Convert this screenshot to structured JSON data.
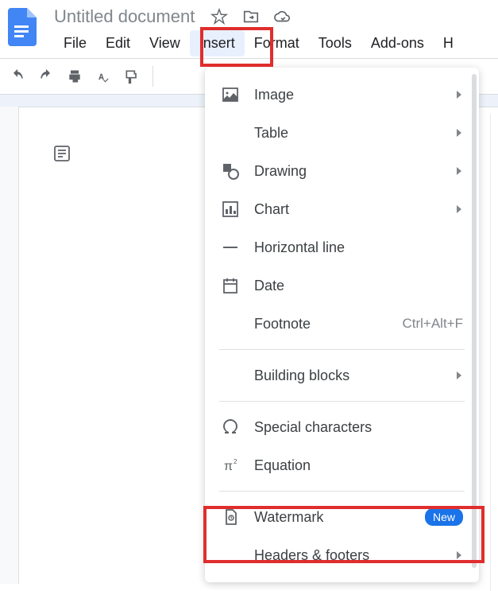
{
  "header": {
    "title": "Untitled document"
  },
  "menubar": {
    "items": [
      "File",
      "Edit",
      "View",
      "Insert",
      "Format",
      "Tools",
      "Add-ons",
      "H"
    ],
    "active_index": 3
  },
  "dropdown": {
    "items": [
      {
        "label": "Image",
        "icon": "image",
        "arrow": true
      },
      {
        "label": "Table",
        "icon": "",
        "arrow": true
      },
      {
        "label": "Drawing",
        "icon": "drawing",
        "arrow": true
      },
      {
        "label": "Chart",
        "icon": "chart",
        "arrow": true
      },
      {
        "label": "Horizontal line",
        "icon": "hline",
        "arrow": false
      },
      {
        "label": "Date",
        "icon": "date",
        "arrow": false
      },
      {
        "label": "Footnote",
        "icon": "",
        "arrow": false,
        "shortcut": "Ctrl+Alt+F"
      },
      {
        "sep": true
      },
      {
        "label": "Building blocks",
        "icon": "",
        "arrow": true
      },
      {
        "sep": true
      },
      {
        "label": "Special characters",
        "icon": "omega",
        "arrow": false
      },
      {
        "label": "Equation",
        "icon": "pi",
        "arrow": false
      },
      {
        "sep": true
      },
      {
        "label": "Watermark",
        "icon": "watermark",
        "arrow": false,
        "badge": "New"
      },
      {
        "label": "Headers & footers",
        "icon": "",
        "arrow": true
      }
    ]
  }
}
